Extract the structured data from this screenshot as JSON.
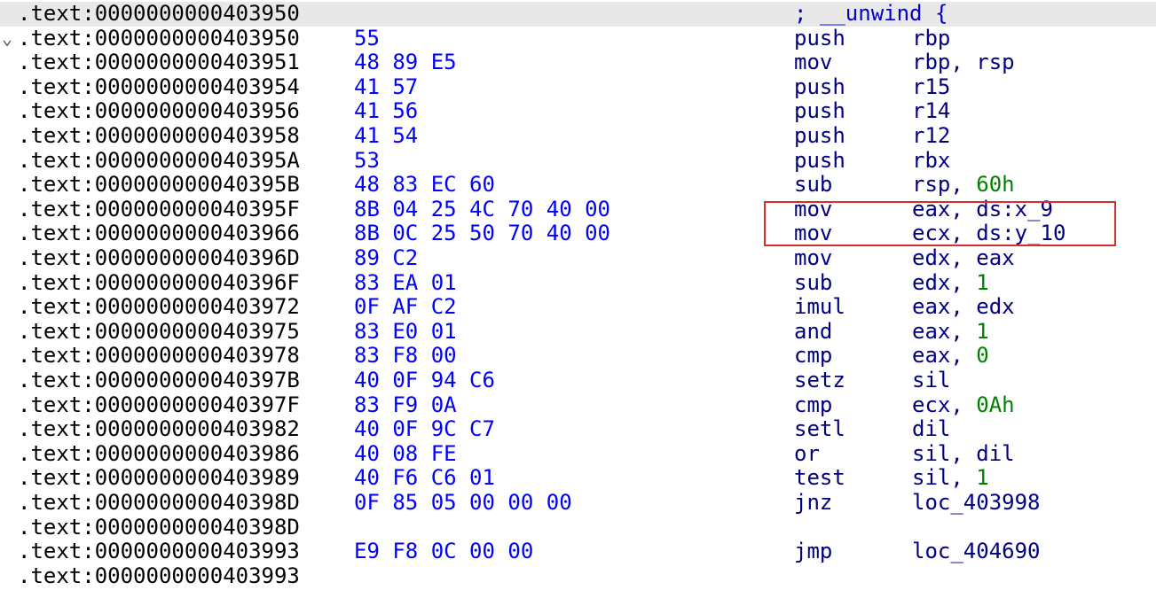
{
  "disassembly": {
    "fold_glyph": "⌄",
    "highlight_color": "#d32f2f",
    "lines": [
      {
        "addr": ".text:0000000000403950",
        "bytes": "",
        "mnem": "",
        "op1": "",
        "sep": "",
        "op2": "",
        "cmt": "; __unwind {",
        "hl": true,
        "fold": false
      },
      {
        "addr": ".text:0000000000403950",
        "bytes": "55",
        "mnem": "push",
        "op1": "rbp",
        "sep": "",
        "op2": "",
        "cmt": "",
        "fold": true
      },
      {
        "addr": ".text:0000000000403951",
        "bytes": "48 89 E5",
        "mnem": "mov",
        "op1": "rbp",
        "sep": ", ",
        "op2": "rsp",
        "cmt": ""
      },
      {
        "addr": ".text:0000000000403954",
        "bytes": "41 57",
        "mnem": "push",
        "op1": "r15",
        "sep": "",
        "op2": "",
        "cmt": ""
      },
      {
        "addr": ".text:0000000000403956",
        "bytes": "41 56",
        "mnem": "push",
        "op1": "r14",
        "sep": "",
        "op2": "",
        "cmt": ""
      },
      {
        "addr": ".text:0000000000403958",
        "bytes": "41 54",
        "mnem": "push",
        "op1": "r12",
        "sep": "",
        "op2": "",
        "cmt": ""
      },
      {
        "addr": ".text:000000000040395A",
        "bytes": "53",
        "mnem": "push",
        "op1": "rbx",
        "sep": "",
        "op2": "",
        "cmt": ""
      },
      {
        "addr": ".text:000000000040395B",
        "bytes": "48 83 EC 60",
        "mnem": "sub",
        "op1": "rsp",
        "sep": ", ",
        "op2": "60h",
        "num": true,
        "cmt": ""
      },
      {
        "addr": ".text:000000000040395F",
        "bytes": "8B 04 25 4C 70 40 00",
        "mnem": "mov",
        "op1": "eax",
        "sep": ", ",
        "op2": "ds:x_9",
        "cmt": ""
      },
      {
        "addr": ".text:0000000000403966",
        "bytes": "8B 0C 25 50 70 40 00",
        "mnem": "mov",
        "op1": "ecx",
        "sep": ", ",
        "op2": "ds:y_10",
        "cmt": ""
      },
      {
        "addr": ".text:000000000040396D",
        "bytes": "89 C2",
        "mnem": "mov",
        "op1": "edx",
        "sep": ", ",
        "op2": "eax",
        "cmt": ""
      },
      {
        "addr": ".text:000000000040396F",
        "bytes": "83 EA 01",
        "mnem": "sub",
        "op1": "edx",
        "sep": ", ",
        "op2": "1",
        "num": true,
        "cmt": ""
      },
      {
        "addr": ".text:0000000000403972",
        "bytes": "0F AF C2",
        "mnem": "imul",
        "op1": "eax",
        "sep": ", ",
        "op2": "edx",
        "cmt": ""
      },
      {
        "addr": ".text:0000000000403975",
        "bytes": "83 E0 01",
        "mnem": "and",
        "op1": "eax",
        "sep": ", ",
        "op2": "1",
        "num": true,
        "cmt": ""
      },
      {
        "addr": ".text:0000000000403978",
        "bytes": "83 F8 00",
        "mnem": "cmp",
        "op1": "eax",
        "sep": ", ",
        "op2": "0",
        "num": true,
        "cmt": ""
      },
      {
        "addr": ".text:000000000040397B",
        "bytes": "40 0F 94 C6",
        "mnem": "setz",
        "op1": "sil",
        "sep": "",
        "op2": "",
        "cmt": ""
      },
      {
        "addr": ".text:000000000040397F",
        "bytes": "83 F9 0A",
        "mnem": "cmp",
        "op1": "ecx",
        "sep": ", ",
        "op2": "0Ah",
        "num": true,
        "cmt": ""
      },
      {
        "addr": ".text:0000000000403982",
        "bytes": "40 0F 9C C7",
        "mnem": "setl",
        "op1": "dil",
        "sep": "",
        "op2": "",
        "cmt": ""
      },
      {
        "addr": ".text:0000000000403986",
        "bytes": "40 08 FE",
        "mnem": "or",
        "op1": "sil",
        "sep": ", ",
        "op2": "dil",
        "cmt": ""
      },
      {
        "addr": ".text:0000000000403989",
        "bytes": "40 F6 C6 01",
        "mnem": "test",
        "op1": "sil",
        "sep": ", ",
        "op2": "1",
        "num": true,
        "cmt": ""
      },
      {
        "addr": ".text:000000000040398D",
        "bytes": "0F 85 05 00 00 00",
        "mnem": "jnz",
        "op1": "loc_403998",
        "sep": "",
        "op2": "",
        "cmt": ""
      },
      {
        "addr": ".text:000000000040398D",
        "bytes": "",
        "mnem": "",
        "op1": "",
        "sep": "",
        "op2": "",
        "cmt": ""
      },
      {
        "addr": ".text:0000000000403993",
        "bytes": "E9 F8 0C 00 00",
        "mnem": "jmp",
        "op1": "loc_404690",
        "sep": "",
        "op2": "",
        "cmt": ""
      },
      {
        "addr": ".text:0000000000403993",
        "bytes": "",
        "mnem": "",
        "op1": "",
        "sep": "",
        "op2": "",
        "cmt": ""
      }
    ]
  }
}
